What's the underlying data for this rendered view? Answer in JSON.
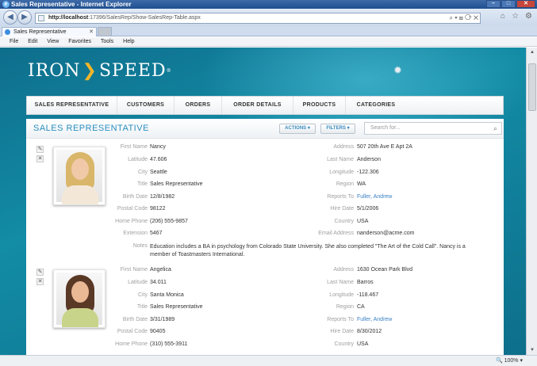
{
  "browser": {
    "window_title": "Sales Representative - Internet Explorer",
    "address_host": "http://localhost",
    "address_path": ":17396/SalesRep/Show-SalesRep-Table.aspx",
    "tab_label": "Sales Representative",
    "menu": [
      "File",
      "Edit",
      "View",
      "Favorites",
      "Tools",
      "Help"
    ],
    "zoom": "100%"
  },
  "brand": {
    "logo_left": "IRON",
    "logo_right": "SPEED",
    "reg": "®"
  },
  "nav": [
    "SALES REPRESENTATIVE",
    "CUSTOMERS",
    "ORDERS",
    "ORDER DETAILS",
    "PRODUCTS",
    "CATEGORIES"
  ],
  "panel": {
    "title": "SALES REPRESENTATIVE",
    "actions_label": "ACTIONS",
    "filters_label": "FILTERS",
    "search_placeholder": "Search for..."
  },
  "labels": {
    "first_name": "First Name",
    "latitude": "Latitude",
    "city": "City",
    "title": "Title",
    "birth_date": "Birth Date",
    "postal_code": "Postal Code",
    "home_phone": "Home Phone",
    "extension": "Extension",
    "notes": "Notes",
    "address": "Address",
    "last_name": "Last Name",
    "longitude": "Longitude",
    "region": "Region",
    "reports_to": "Reports To",
    "hire_date": "Hire Date",
    "country": "Country",
    "email": "Email Address"
  },
  "records": [
    {
      "first_name": "Nancy",
      "latitude": "47.606",
      "city": "Seattle",
      "title": "Sales Representative",
      "birth_date": "12/8/1982",
      "postal_code": "98122",
      "home_phone": "(206) 555-9857",
      "extension": "5467",
      "address": "507 20th Ave E Apt 2A",
      "last_name": "Anderson",
      "longitude": "-122.306",
      "region": "WA",
      "reports_to": "Fuller, Andrew",
      "hire_date": "5/1/2006",
      "country": "USA",
      "email": "nanderson@acme.com",
      "notes": "Education includes a BA in psychology from Colorado State University. She also completed \"The Art of the Cold Call\". Nancy is a member of Toastmasters International."
    },
    {
      "first_name": "Angelica",
      "latitude": "34.011",
      "city": "Santa Monica",
      "title": "Sales Representative",
      "birth_date": "3/31/1989",
      "postal_code": "90405",
      "home_phone": "(310) 555-3911",
      "address": "1630 Ocean Park Blvd",
      "last_name": "Barros",
      "longitude": "-118.467",
      "region": "CA",
      "reports_to": "Fuller, Andrew",
      "hire_date": "8/30/2012",
      "country": "USA"
    }
  ]
}
